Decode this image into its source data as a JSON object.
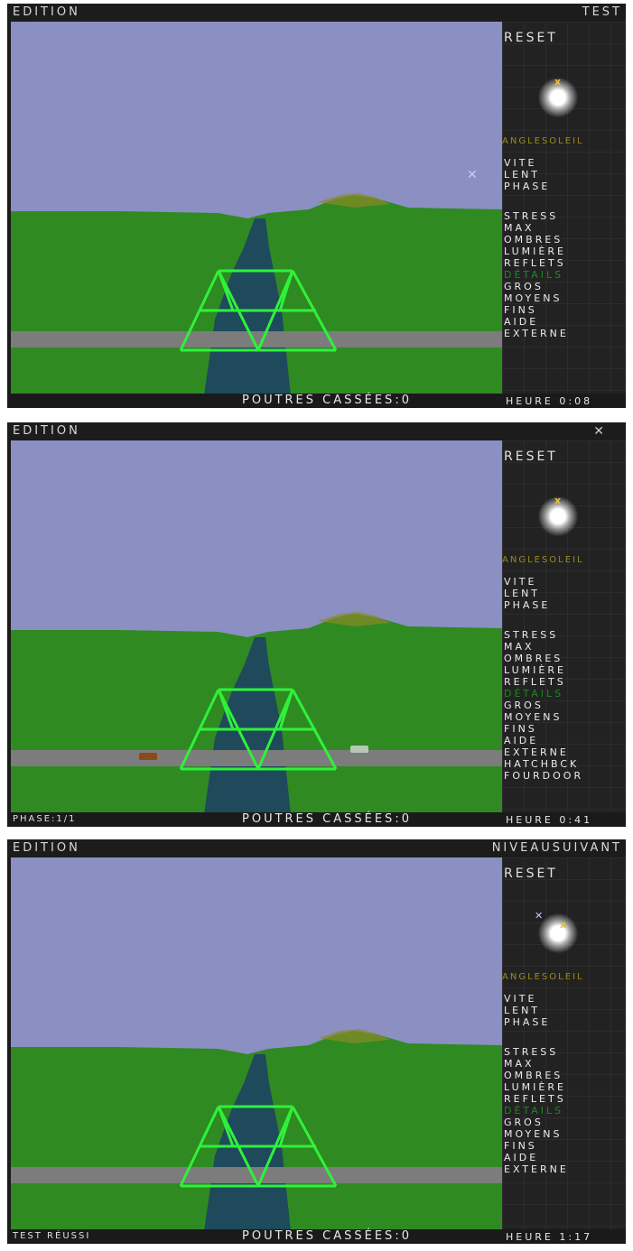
{
  "frames": [
    {
      "top_left": "EDITION",
      "top_right": "TEST",
      "reset": "RESET",
      "angle_label": "ANGLESOLEIL",
      "menu": [
        "VITE",
        "LENT",
        "PHASE",
        "STRESS",
        "MAX",
        "OMBRES",
        "LUMIÈRE",
        "REFLETS",
        "DÉTAILS",
        "GROS",
        "MOYENS",
        "FINS",
        "AIDE",
        "EXTERNE"
      ],
      "bottom_left": "",
      "broken_label": "POUTRES CASSÉES:0",
      "clock": "HEURE 0:08"
    },
    {
      "top_left": "EDITION",
      "top_right": "",
      "reset": "RESET",
      "angle_label": "ANGLESOLEIL",
      "menu": [
        "VITE",
        "LENT",
        "PHASE",
        "STRESS",
        "MAX",
        "OMBRES",
        "LUMIÈRE",
        "REFLETS",
        "DÉTAILS",
        "GROS",
        "MOYENS",
        "FINS",
        "AIDE",
        "EXTERNE",
        "HATCHBCK",
        "FOURDOOR"
      ],
      "bottom_left": "PHASE:1/1",
      "broken_label": "POUTRES CASSÉES:0",
      "clock": "HEURE 0:41"
    },
    {
      "top_left": "EDITION",
      "top_right": "NIVEAUSUIVANT",
      "reset": "RESET",
      "angle_label": "ANGLESOLEIL",
      "menu": [
        "VITE",
        "LENT",
        "PHASE",
        "STRESS",
        "MAX",
        "OMBRES",
        "LUMIÈRE",
        "REFLETS",
        "DÉTAILS",
        "GROS",
        "MOYENS",
        "FINS",
        "AIDE",
        "EXTERNE"
      ],
      "bottom_left": "TEST RÉUSSI",
      "broken_label": "POUTRES CASSÉES:0",
      "clock": "HEURE 1:17"
    }
  ],
  "colors": {
    "sky": "#8c8fc2",
    "grass": "#2f8a22",
    "river": "#1e4a5c",
    "truss": "#2ef23a",
    "road": "#808080"
  }
}
